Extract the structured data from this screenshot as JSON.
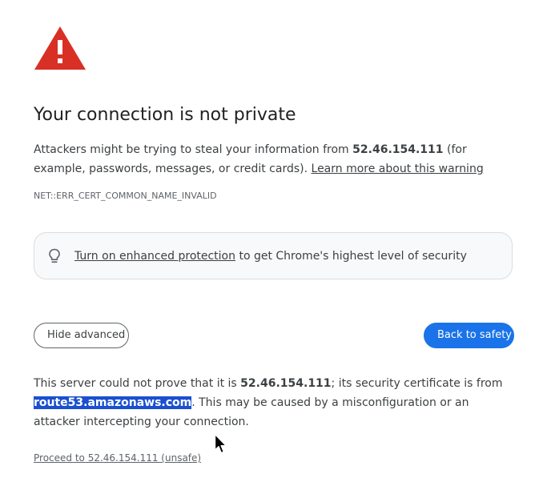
{
  "colors": {
    "warning_red": "#d93025",
    "primary_blue": "#1a73e8",
    "selection_blue": "#1a4fd0",
    "text": "#3c4043"
  },
  "icons": {
    "warning": "warning-triangle-icon",
    "bulb": "lightbulb-icon",
    "cursor": "mouse-cursor-icon"
  },
  "page": {
    "title": "Your connection is not private",
    "explanation": {
      "before_host": "Attackers might be trying to steal your information from ",
      "host": "52.46.154.111",
      "after_host": " (for example, passwords, messages, or credit cards). ",
      "learn_more": "Learn more about this warning"
    },
    "error_code": "NET::ERR_CERT_COMMON_NAME_INVALID",
    "enhanced_protection": {
      "link": "Turn on enhanced protection",
      "rest": " to get Chrome's highest level of security"
    },
    "buttons": {
      "hide_advanced": "Hide advanced",
      "back_to_safety": "Back to safety"
    },
    "details": {
      "part1": "This server could not prove that it is ",
      "host": "52.46.154.111",
      "part2": "; its security certificate is from ",
      "issuer": "route53.amazonaws.com",
      "part3": ". This may be caused by a misconfiguration or an attacker intercepting your connection."
    },
    "proceed_link": "Proceed to 52.46.154.111 (unsafe)"
  }
}
